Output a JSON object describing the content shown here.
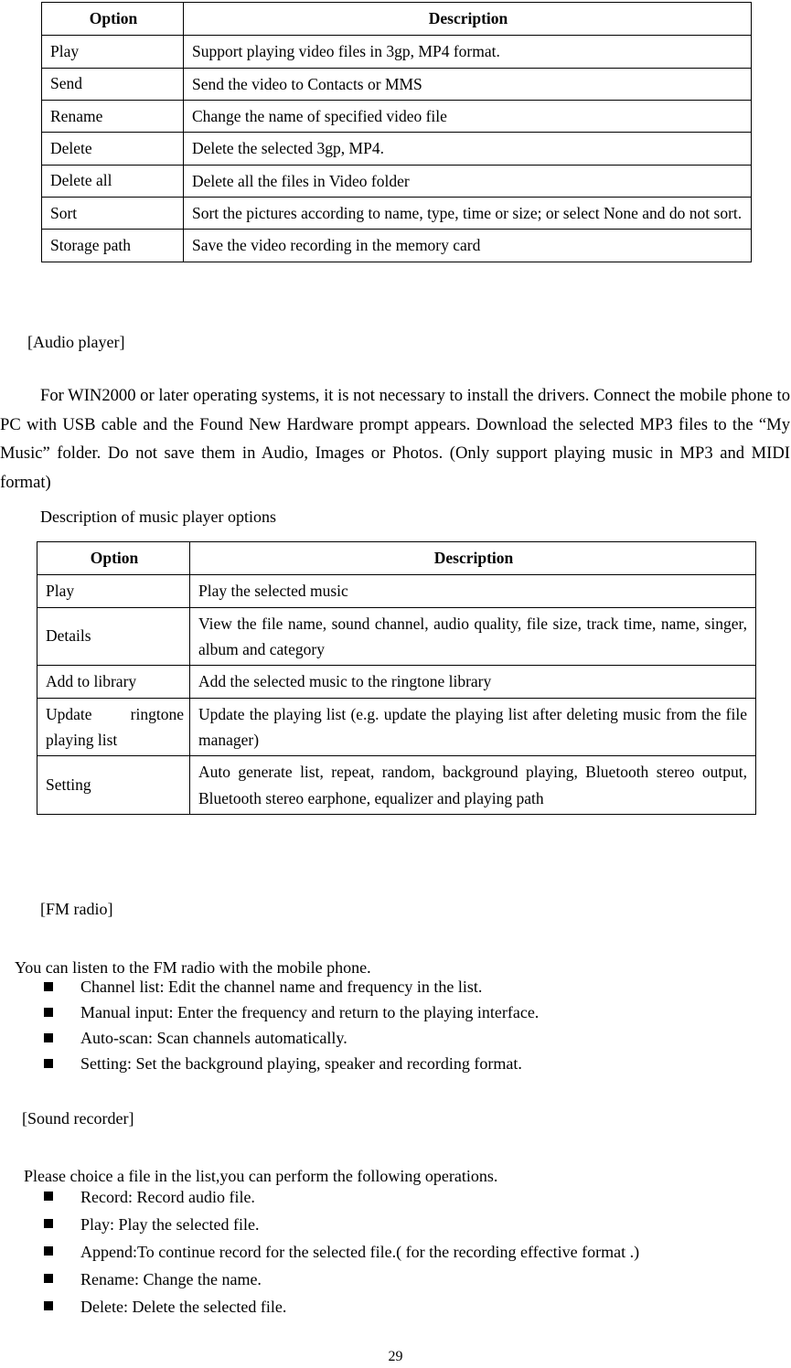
{
  "document": {
    "page_number": "29"
  },
  "video_table": {
    "headers": [
      "Option",
      "Description"
    ],
    "rows": [
      {
        "option": "Play",
        "description": "Support playing video files in 3gp, MP4 format."
      },
      {
        "option": "Send",
        "description": "Send the video to Contacts or MMS"
      },
      {
        "option": "Rename",
        "description": "Change the name of specified video file"
      },
      {
        "option": "Delete",
        "description": "Delete the selected 3gp, MP4."
      },
      {
        "option": "Delete all",
        "description": "Delete all the files in Video folder"
      },
      {
        "option": "Sort",
        "description": "Sort the pictures according to name, type, time or size; or select None and do not sort."
      },
      {
        "option": "Storage path",
        "description": "Save the video recording in the memory card"
      }
    ]
  },
  "audio_player": {
    "heading": "[Audio player]",
    "paragraph": "For WIN2000 or later operating systems, it is not necessary to install the drivers. Connect the mobile phone to PC with USB cable and the Found New Hardware prompt appears. Download the selected MP3 files to the “My Music” folder. Do not save them in Audio, Images or Photos. (Only support playing music in MP3 and MIDI format)",
    "caption": "Description of music player options"
  },
  "music_table": {
    "headers": [
      "Option",
      "Description"
    ],
    "rows": [
      {
        "option": "Play",
        "description": "Play the selected music"
      },
      {
        "option": "Details",
        "description": "View the file name, sound channel, audio quality, file size, track time, name, singer, album and category"
      },
      {
        "option": "Add to library",
        "description": "Add the selected music to the ringtone library"
      },
      {
        "option": "Update ringtone playing list",
        "description": "Update the playing list (e.g. update the playing list after deleting music from the file manager)"
      },
      {
        "option": "Setting",
        "description": "Auto generate list, repeat, random, background playing, Bluetooth stereo output, Bluetooth stereo earphone, equalizer and playing path"
      }
    ]
  },
  "fm_radio": {
    "heading": "[FM radio]",
    "intro": "You can listen to the FM radio with the mobile phone.",
    "bullets": [
      "Channel list: Edit the channel name and frequency in the list.",
      "Manual input: Enter the frequency and return to the playing interface.",
      "Auto-scan: Scan channels automatically.",
      "Setting: Set the background playing, speaker and recording format."
    ]
  },
  "sound_recorder": {
    "heading": "[Sound recorder]",
    "intro": "Please choice a file in the list,you can perform the following operations.",
    "bullets": [
      "Record: Record audio file.",
      "Play: Play the selected file.",
      "Append:To continue record for the selected file.( for the recording effective format .)",
      "Rename: Change the name.",
      "Delete: Delete the selected file."
    ]
  }
}
